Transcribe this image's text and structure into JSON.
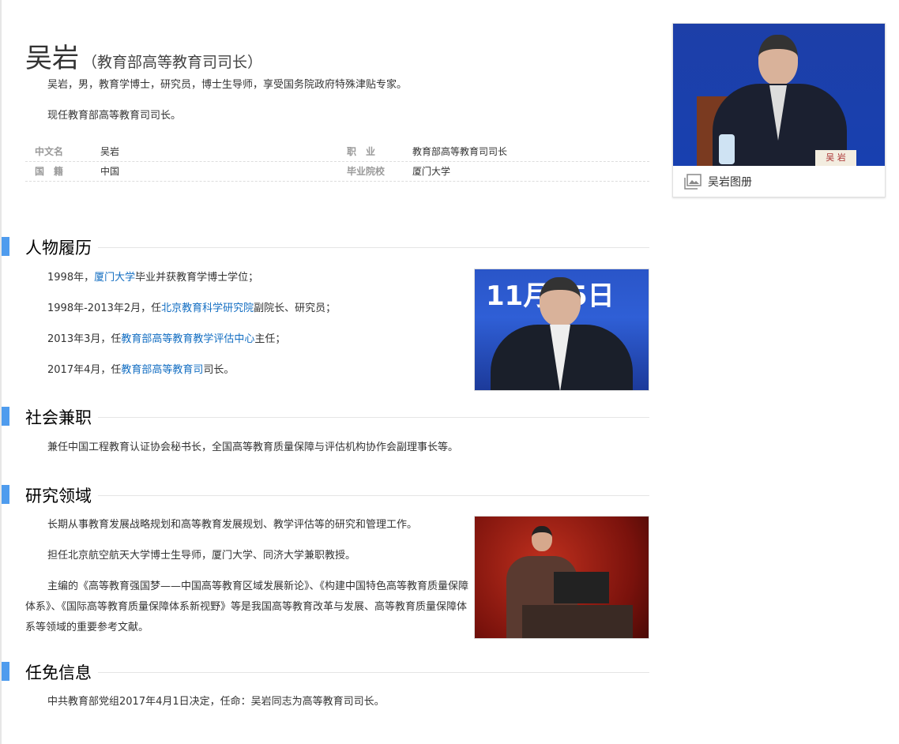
{
  "title": {
    "name": "吴岩",
    "subtitle": "（教育部高等教育司司长）"
  },
  "lead": [
    "吴岩，男，教育学博士，研究员，博士生导师，享受国务院政府特殊津贴专家。",
    "现任教育部高等教育司司长。"
  ],
  "basic_info": [
    {
      "label": "中文名",
      "value": "吴岩",
      "label2": "职　业",
      "value2": "教育部高等教育司司长"
    },
    {
      "label": "国　籍",
      "value": "中国",
      "label2": "毕业院校",
      "value2": "厦门大学"
    }
  ],
  "album": {
    "caption": "吴岩图册",
    "nameplate": "吴 岩"
  },
  "sections": {
    "career": {
      "title": "人物履历",
      "items": [
        {
          "pre": "1998年，",
          "link": "厦门大学",
          "post": "毕业并获教育学博士学位；"
        },
        {
          "pre": "1998年-2013年2月，任",
          "link": "北京教育科学研究院",
          "post": "副院长、研究员；"
        },
        {
          "pre": "2013年3月，任",
          "link": "教育部高等教育教学评估中心",
          "post": "主任；"
        },
        {
          "pre": "2017年4月，任",
          "link": "教育部高等教育司",
          "post": "司长。"
        }
      ],
      "photo_banner": "11月25日"
    },
    "social": {
      "title": "社会兼职",
      "text": "兼任中国工程教育认证协会秘书长，全国高等教育质量保障与评估机构协作会副理事长等。"
    },
    "research": {
      "title": "研究领域",
      "items": [
        "长期从事教育发展战略规划和高等教育发展规划、教学评估等的研究和管理工作。",
        "担任北京航空航天大学博士生导师，厦门大学、同济大学兼职教授。",
        "主编的《高等教育强国梦——中国高等教育区域发展新论》、《构建中国特色高等教育质量保障体系》、《国际高等教育质量保障体系新视野》等是我国高等教育改革与发展、高等教育质量保障体系等领域的重要参考文献。"
      ]
    },
    "appointment": {
      "title": "任免信息",
      "text": "中共教育部党组2017年4月1日决定，任命：吴岩同志为高等教育司司长。"
    }
  }
}
